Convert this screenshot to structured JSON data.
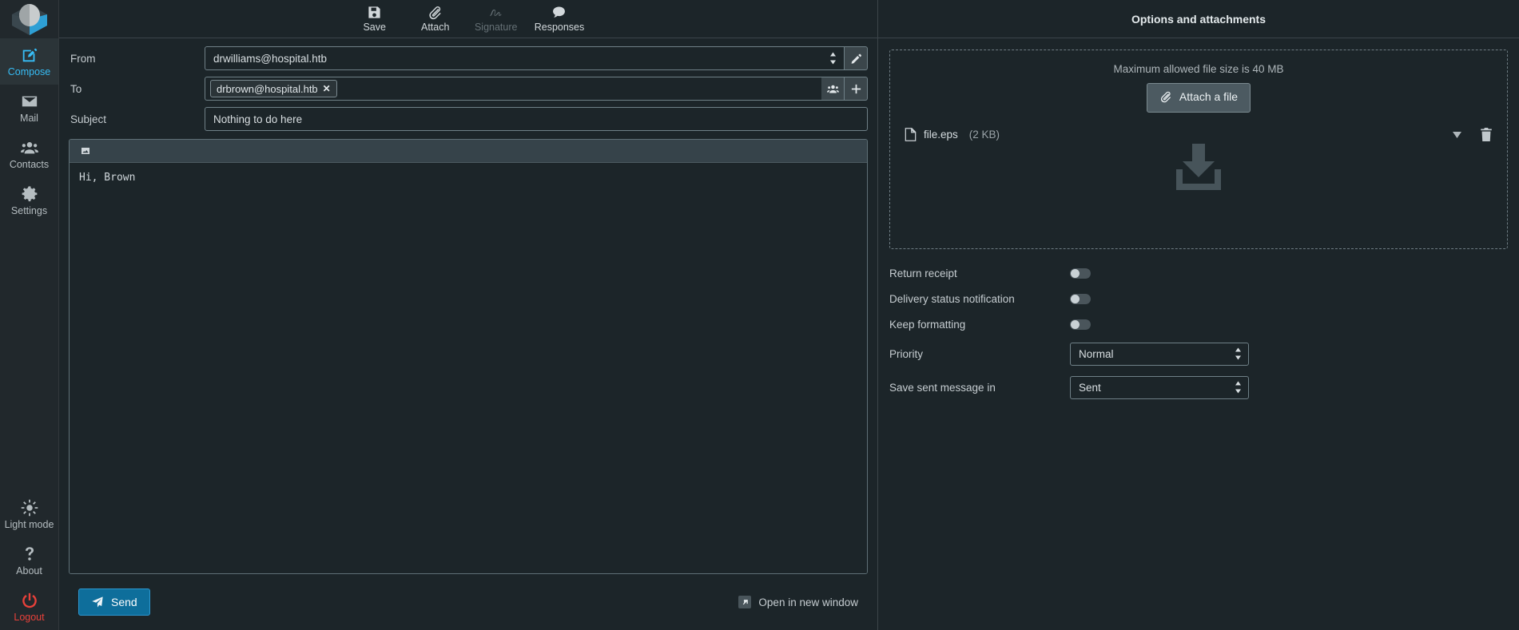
{
  "sidebar": {
    "logo_name": "roundcube-logo",
    "items": [
      {
        "label": "Compose",
        "icon": "compose-icon",
        "active": true
      },
      {
        "label": "Mail",
        "icon": "envelope-icon",
        "active": false
      },
      {
        "label": "Contacts",
        "icon": "contacts-icon",
        "active": false
      },
      {
        "label": "Settings",
        "icon": "gear-icon",
        "active": false
      }
    ],
    "bottom_items": [
      {
        "label": "Light mode",
        "icon": "sun-icon"
      },
      {
        "label": "About",
        "icon": "question-icon"
      },
      {
        "label": "Logout",
        "icon": "power-icon"
      }
    ]
  },
  "toolbar": {
    "save_label": "Save",
    "attach_label": "Attach",
    "signature_label": "Signature",
    "responses_label": "Responses"
  },
  "compose": {
    "from_label": "From",
    "from_value": "drwilliams@hospital.htb",
    "from_edit_icon": "pencil-icon",
    "to_label": "To",
    "to_recipients": [
      "drbrown@hospital.htb"
    ],
    "to_contacts_icon": "contacts-icon",
    "to_add_icon": "plus-icon",
    "subject_label": "Subject",
    "subject_value": "Nothing to do here",
    "editor_image_icon": "image-icon",
    "body_text": "Hi, Brown",
    "send_label": "Send",
    "send_icon": "paper-plane-icon",
    "open_new_window_label": "Open in new window",
    "open_new_window_icon": "external-link-icon"
  },
  "options_panel": {
    "title": "Options and attachments",
    "max_size_text": "Maximum allowed file size is 40 MB",
    "attach_button_label": "Attach a file",
    "attach_button_icon": "paperclip-icon",
    "dropzone_icon": "download-tray-icon",
    "attachments": [
      {
        "name": "file.eps",
        "size": "(2 KB)",
        "file_icon": "file-icon",
        "menu_icon": "chevron-down-icon",
        "delete_icon": "trash-icon"
      }
    ],
    "toggles": [
      {
        "label": "Return receipt",
        "state": "off"
      },
      {
        "label": "Delivery status notification",
        "state": "off"
      },
      {
        "label": "Keep formatting",
        "state": "off"
      }
    ],
    "selects": [
      {
        "label": "Priority",
        "value": "Normal"
      },
      {
        "label": "Save sent message in",
        "value": "Sent"
      }
    ]
  },
  "colors": {
    "accent": "#37bdf6",
    "send_button": "#0e6e9b",
    "logout": "#e8413a",
    "background": "#1c2529",
    "sidebar": "#21282c"
  }
}
